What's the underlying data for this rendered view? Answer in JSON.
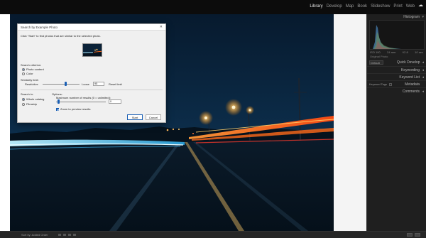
{
  "modules": [
    "Library",
    "Develop",
    "Map",
    "Book",
    "Slideshow",
    "Print",
    "Web"
  ],
  "active_module": "Library",
  "right_panel": {
    "histogram_label": "Histogram",
    "histogram_meta": [
      "ISO 100",
      "24 mm",
      "f/2.8",
      "10 sec"
    ],
    "original_photo_label": "Original Photo",
    "preset_value": "Default",
    "quick_develop_label": "Quick Develop",
    "keywording_label": "Keywording",
    "keyword_list_label": "Keyword List",
    "keyword_tags_label": "Keyword Tags",
    "metadata_label": "Metadata",
    "comments_label": "Comments"
  },
  "bottom_bar": {
    "sort_label": "Sort by: Added Order"
  },
  "dialog": {
    "title": "Search by Example Photo",
    "instruction": "Click \"Start\" to find photos that are similar to the selected photo.",
    "search_criterion_label": "Search criterion:",
    "option_photo_content": "Photo content",
    "option_color": "Color",
    "similarity_label": "Similarity limit:",
    "restrictive_label": "Restrictive",
    "loose_label": "Loose",
    "similarity_value": "95",
    "reset_label": "Reset limit",
    "search_in_label": "Search in:",
    "option_whole_catalog": "Whole catalog",
    "option_filmstrip": "Filmstrip",
    "options_label": "Options:",
    "max_results_label": "Maximum number of results (0 = unlimited):",
    "max_results_value": "0",
    "zoom_preview_label": "Zoom to preview results",
    "start_button": "Start",
    "cancel_button": "Cancel",
    "close_glyph": "✕"
  },
  "colors": {
    "accent": "#1a5fb4",
    "panel_bg": "#1f1f1f",
    "light_trail": "#ff6a1a",
    "blue_trail": "#6fd0ff"
  },
  "icons": [
    "cloud-icon",
    "disclosure-triangle-icon",
    "close-icon",
    "radio-icon",
    "checkbox-icon"
  ]
}
